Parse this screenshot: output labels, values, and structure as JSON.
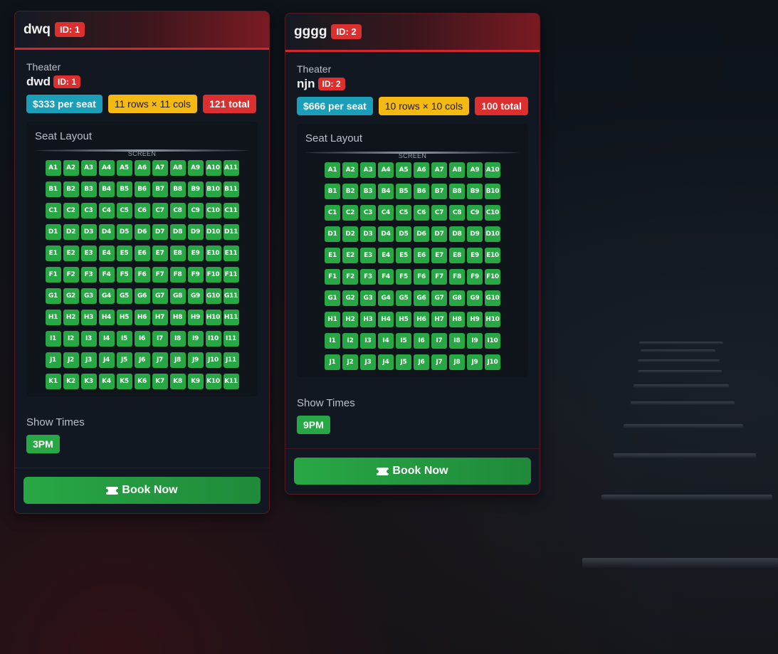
{
  "cards": [
    {
      "title": "dwq",
      "id_badge": "ID: 1",
      "theater_label": "Theater",
      "theater_name": "dwd",
      "theater_id_badge": "ID: 1",
      "price_chip": "$333 per seat",
      "size_chip": "11 rows × 11 cols",
      "total_chip": "121 total",
      "seat_layout_label": "Seat Layout",
      "screen_label": "SCREEN",
      "rows": [
        "A",
        "B",
        "C",
        "D",
        "E",
        "F",
        "G",
        "H",
        "I",
        "J",
        "K"
      ],
      "cols": 11,
      "show_times_label": "Show Times",
      "show_times": [
        "3PM"
      ],
      "book_label": "Book Now"
    },
    {
      "title": "gggg",
      "id_badge": "ID: 2",
      "theater_label": "Theater",
      "theater_name": "njn",
      "theater_id_badge": "ID: 2",
      "price_chip": "$666 per seat",
      "size_chip": "10 rows × 10 cols",
      "total_chip": "100 total",
      "seat_layout_label": "Seat Layout",
      "screen_label": "SCREEN",
      "rows": [
        "A",
        "B",
        "C",
        "D",
        "E",
        "F",
        "G",
        "H",
        "I",
        "J"
      ],
      "cols": 10,
      "show_times_label": "Show Times",
      "show_times": [
        "9PM"
      ],
      "book_label": "Book Now"
    }
  ],
  "colors": {
    "accent_red": "#dc2f2f",
    "seat_available": "#28a745",
    "info": "#1b9fb8",
    "warning": "#f5b914"
  }
}
